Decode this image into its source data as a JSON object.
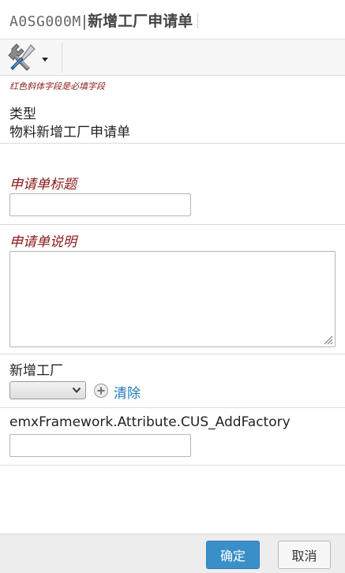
{
  "header": {
    "code": "A0SG000M",
    "separator": "|",
    "title": "新增工厂申请单"
  },
  "toolbar": {
    "tools_icon": "wrench-screwdriver-icon",
    "dropdown_icon": "caret-down-icon"
  },
  "form": {
    "required_hint": "红色斜体字段是必填字段",
    "type_field": {
      "label": "类型",
      "value": "物料新增工厂申请单"
    },
    "title_field": {
      "label": "申请单标题",
      "value": ""
    },
    "description_field": {
      "label": "申请单说明",
      "value": ""
    },
    "factory_field": {
      "label": "新增工厂",
      "selected": "",
      "add_icon": "plus-circle-icon",
      "clear_label": "清除"
    },
    "attribute_field": {
      "label": "emxFramework.Attribute.CUS_AddFactory",
      "value": ""
    }
  },
  "footer": {
    "ok_label": "确定",
    "cancel_label": "取消"
  },
  "colors": {
    "required_text": "#8b1a1a",
    "link": "#1f7ab8",
    "primary_button": "#3a8fc9",
    "footer_bg": "#ededed"
  }
}
